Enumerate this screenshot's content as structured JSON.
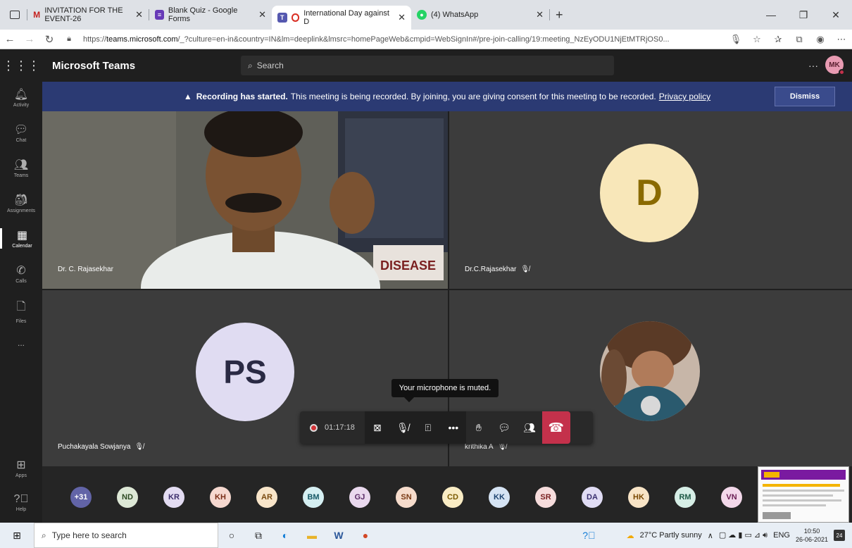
{
  "browser": {
    "tabs": [
      {
        "label": "INVITATION FOR THE EVENT-26",
        "icon": "gmail-icon",
        "active": false
      },
      {
        "label": "Blank Quiz - Google Forms",
        "icon": "google-forms-icon",
        "active": false
      },
      {
        "label": "International Day against D",
        "icon": "teams-icon",
        "active": true
      },
      {
        "label": "(4) WhatsApp",
        "icon": "whatsapp-icon",
        "active": false
      }
    ],
    "url_prefix": "https://",
    "url_host": "teams.microsoft.com",
    "url_rest": "/_?culture=en-in&country=IN&lm=deeplink&lmsrc=homePageWeb&cmpid=WebSignIn#/pre-join-calling/19:meeting_NzEyODU1NjEtMTRjOS0..."
  },
  "teams": {
    "app_name": "Microsoft Teams",
    "search_placeholder": "Search",
    "user_initials": "MK",
    "rail": [
      {
        "label": "Activity",
        "icon": "bell-icon"
      },
      {
        "label": "Chat",
        "icon": "chat-icon"
      },
      {
        "label": "Teams",
        "icon": "teams-group-icon"
      },
      {
        "label": "Assignments",
        "icon": "assignments-icon"
      },
      {
        "label": "Calendar",
        "icon": "calendar-icon"
      },
      {
        "label": "Calls",
        "icon": "phone-icon"
      },
      {
        "label": "Files",
        "icon": "file-icon"
      },
      {
        "label": "...",
        "icon": "more-icon"
      },
      {
        "label": "Apps",
        "icon": "apps-icon"
      },
      {
        "label": "Help",
        "icon": "help-icon"
      }
    ]
  },
  "banner": {
    "bold": "Recording has started.",
    "text": "This meeting is being recorded. By joining, you are giving consent for this meeting to be recorded.",
    "link": "Privacy policy",
    "dismiss": "Dismiss",
    "color": "#2b3a73"
  },
  "tiles": [
    {
      "name": "Dr. C. Rajasekhar",
      "type": "video",
      "muted": false
    },
    {
      "name": "Dr.C.Rajasekhar",
      "initials": "D",
      "type": "avatar",
      "muted": true,
      "bg": "#f8e7b9",
      "fg": "#8a6a00"
    },
    {
      "name": "Puchakayala Sowjanya",
      "initials": "PS",
      "type": "avatar",
      "muted": true,
      "bg": "#e0dcf2",
      "fg": "#2a2a44"
    },
    {
      "name": "krithika A",
      "type": "photo",
      "muted": true
    }
  ],
  "tooltip": "Your microphone is muted.",
  "controls": {
    "timer": "01:17:18"
  },
  "participants": [
    {
      "initials": "+31",
      "bg": "#6264a7",
      "fg": "#ffffff"
    },
    {
      "initials": "ND",
      "bg": "#dde8d6",
      "fg": "#2d4a22"
    },
    {
      "initials": "KR",
      "bg": "#e3dcf2",
      "fg": "#3c2e6b"
    },
    {
      "initials": "KH",
      "bg": "#f6d8cf",
      "fg": "#7a2e18"
    },
    {
      "initials": "AR",
      "bg": "#f8e5c9",
      "fg": "#7a4a10"
    },
    {
      "initials": "BM",
      "bg": "#d5eff2",
      "fg": "#155866"
    },
    {
      "initials": "GJ",
      "bg": "#ead9ee",
      "fg": "#5a2a66"
    },
    {
      "initials": "SN",
      "bg": "#f6dccc",
      "fg": "#7a3a14"
    },
    {
      "initials": "CD",
      "bg": "#f9ecc4",
      "fg": "#7a5a00"
    },
    {
      "initials": "KK",
      "bg": "#d6e4f4",
      "fg": "#1e4470"
    },
    {
      "initials": "SR",
      "bg": "#f6dcdc",
      "fg": "#7a2222"
    },
    {
      "initials": "DA",
      "bg": "#e0dcf4",
      "fg": "#3a3070"
    },
    {
      "initials": "HK",
      "bg": "#f8e4c6",
      "fg": "#7a4800"
    },
    {
      "initials": "RM",
      "bg": "#d6eee6",
      "fg": "#1e5a46"
    },
    {
      "initials": "VN",
      "bg": "#f3d8ea",
      "fg": "#6a1e54"
    }
  ],
  "taskbar": {
    "search_placeholder": "Type here to search",
    "weather": "27°C  Partly sunny",
    "lang": "ENG",
    "time": "10:50",
    "date": "26-06-2021",
    "notifications": "24"
  }
}
